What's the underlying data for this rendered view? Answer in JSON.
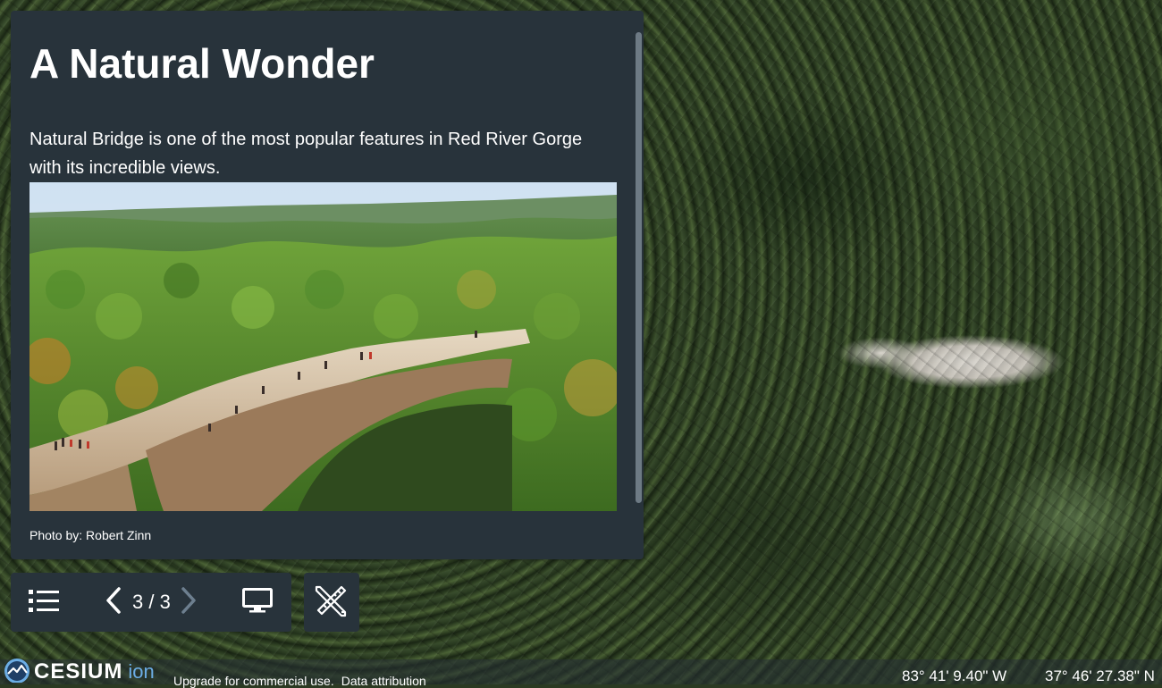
{
  "story": {
    "title": "A Natural Wonder",
    "description": "Natural Bridge is one of the most popular features in Red River Gorge with its incredible views.",
    "photo_caption": "Photo by: Robert Zinn"
  },
  "toolbar": {
    "counter": "3 / 3",
    "list_icon": "list-icon",
    "prev_icon": "chevron-left-icon",
    "next_icon": "chevron-right-icon",
    "present_icon": "monitor-icon",
    "tools_icon": "ruler-pencil-icon"
  },
  "credits": {
    "logo_text": "CESIUM",
    "logo_suffix": "ion",
    "upgrade": "Upgrade for commercial use.",
    "attribution": "Data attribution"
  },
  "coordinates": {
    "longitude": "83° 41' 9.40\" W",
    "latitude": "37° 46' 27.38\" N"
  },
  "colors": {
    "panel": "#28333b",
    "accent_ion": "#6cade5",
    "text": "#ffffff"
  }
}
